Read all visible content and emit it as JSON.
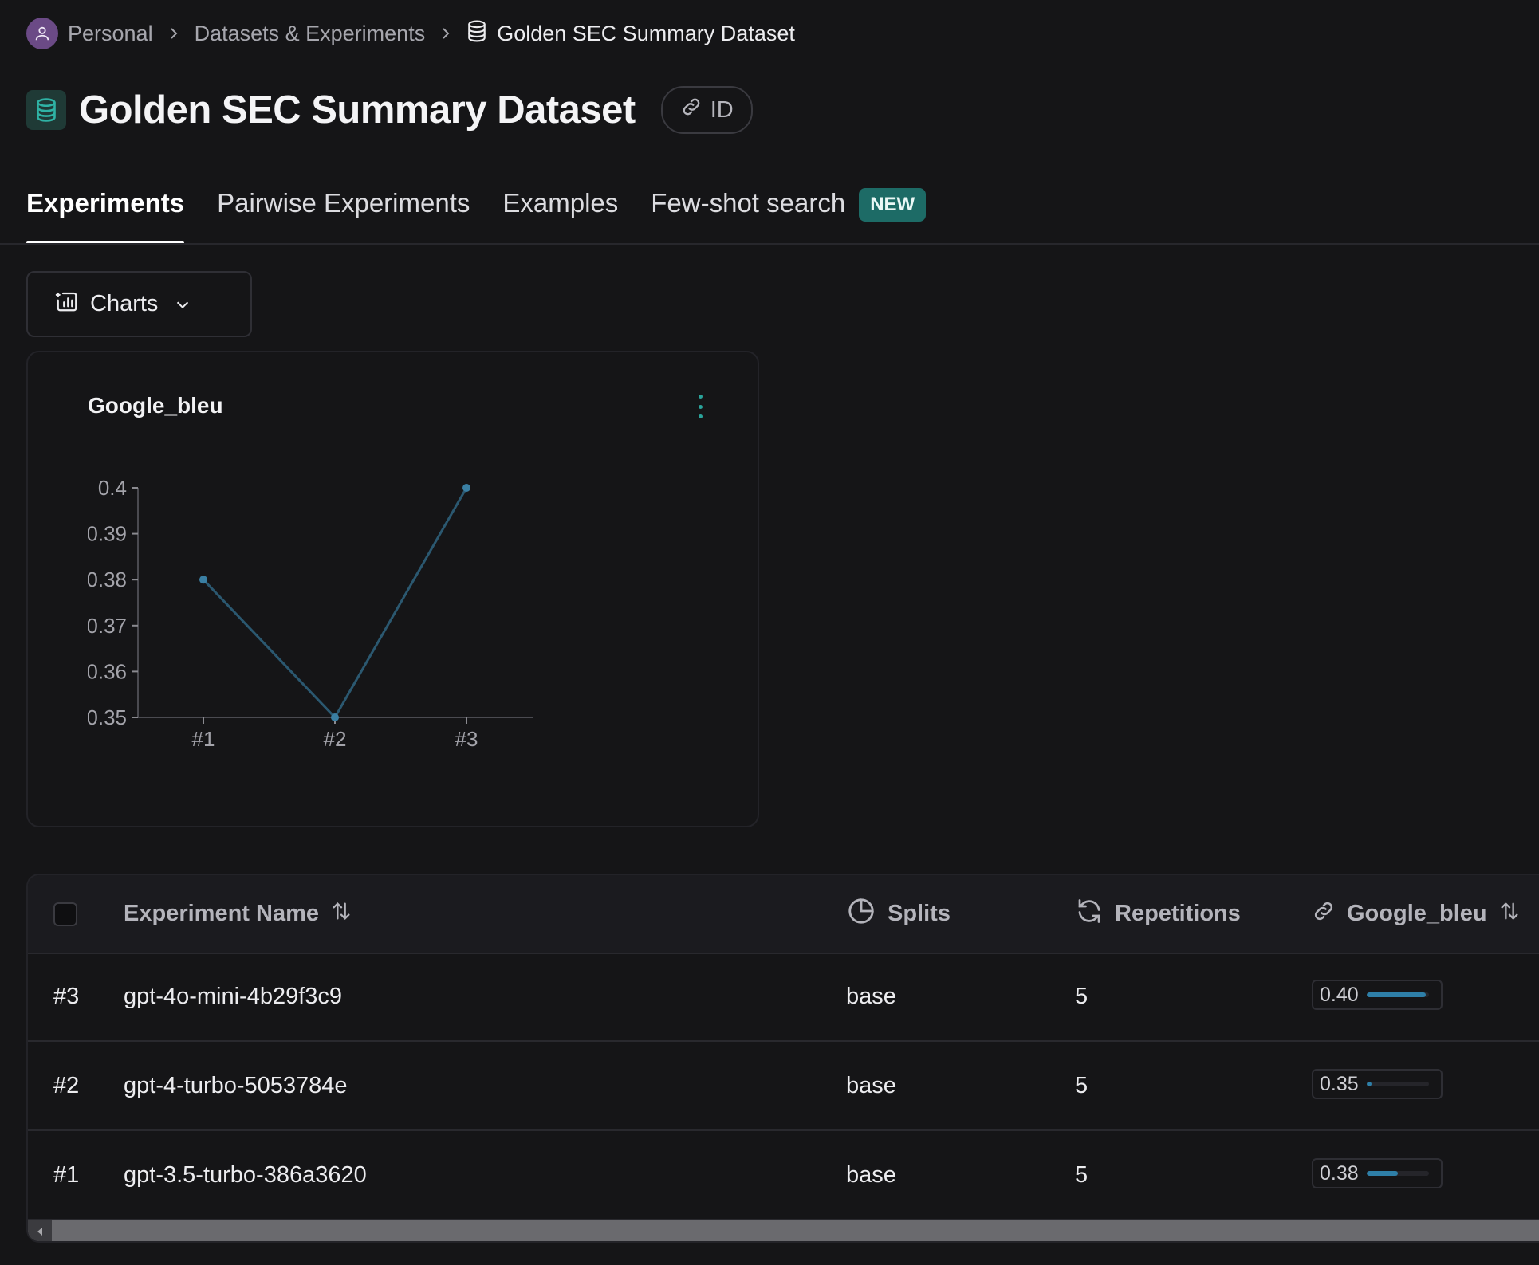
{
  "breadcrumb": {
    "items": [
      "Personal",
      "Datasets & Experiments",
      "Golden SEC Summary Dataset"
    ]
  },
  "page": {
    "title": "Golden SEC Summary Dataset",
    "id_label": "ID"
  },
  "tabs": [
    {
      "label": "Experiments",
      "active": true
    },
    {
      "label": "Pairwise Experiments"
    },
    {
      "label": "Examples"
    },
    {
      "label": "Few-shot search",
      "badge": "NEW"
    }
  ],
  "charts_button": {
    "label": "Charts"
  },
  "chart_data": {
    "type": "line",
    "title": "Google_bleu",
    "categories": [
      "#1",
      "#2",
      "#3"
    ],
    "values": [
      0.38,
      0.35,
      0.4
    ],
    "ylim": [
      0.35,
      0.4
    ],
    "yticks": [
      "0.4",
      "0.39",
      "0.38",
      "0.37",
      "0.36",
      "0.35"
    ],
    "ytick_values": [
      0.4,
      0.39,
      0.38,
      0.37,
      0.36,
      0.35
    ],
    "grid": false,
    "line_color": "#2b5870",
    "point_color": "#3a7fa3"
  },
  "table": {
    "columns": {
      "name": "Experiment Name",
      "splits": "Splits",
      "repetitions": "Repetitions",
      "google_bleu": "Google_bleu"
    },
    "rows": [
      {
        "index": "#3",
        "name": "gpt-4o-mini-4b29f3c9",
        "split": "base",
        "repetitions": "5",
        "score": "0.40",
        "score_fraction": 0.95
      },
      {
        "index": "#2",
        "name": "gpt-4-turbo-5053784e",
        "split": "base",
        "repetitions": "5",
        "score": "0.35",
        "score_fraction": 0.08
      },
      {
        "index": "#1",
        "name": "gpt-3.5-turbo-386a3620",
        "split": "base",
        "repetitions": "5",
        "score": "0.38",
        "score_fraction": 0.5
      }
    ]
  },
  "colors": {
    "accent_teal": "#1d6b66",
    "bar_fill": "#2e7fa8"
  }
}
